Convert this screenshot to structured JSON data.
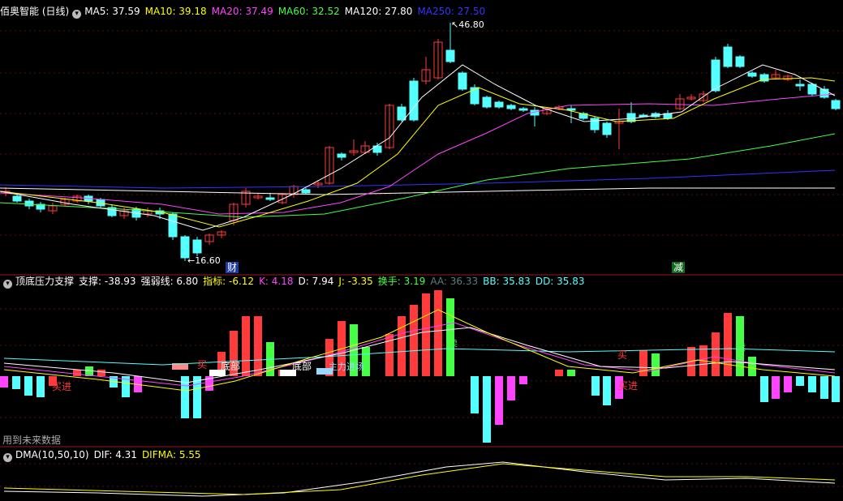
{
  "main": {
    "title": "佰奥智能 (日线)",
    "ma": [
      {
        "label": "MA5: 37.59",
        "color": "#ffffff"
      },
      {
        "label": "MA10: 39.18",
        "color": "#ffff00"
      },
      {
        "label": "MA20: 37.49",
        "color": "#ff44ff"
      },
      {
        "label": "MA60: 32.52",
        "color": "#44ff44"
      },
      {
        "label": "MA120: 27.80",
        "color": "#ffffff"
      },
      {
        "label": "MA250: 27.50",
        "color": "#3333ff"
      }
    ],
    "high_label": "46.80",
    "low_label": "16.60",
    "tag_cai": "财",
    "tag_jian": "减",
    "colors": {
      "up": "#ff3b3b",
      "down": "#54ffff"
    }
  },
  "indicator": {
    "title": "顶底压力支撑",
    "values": [
      {
        "label": "支撑: -38.93",
        "color": "#ffffff"
      },
      {
        "label": "强弱线: 6.80",
        "color": "#ffffff"
      },
      {
        "label": "指标: -6.12",
        "color": "#ffff00"
      },
      {
        "label": "K: 4.18",
        "color": "#ff44ff"
      },
      {
        "label": "D: 7.94",
        "color": "#ffffff"
      },
      {
        "label": "J: -3.35",
        "color": "#ffff00"
      },
      {
        "label": "换手: 3.19",
        "color": "#44ff44"
      },
      {
        "label": "AA: 36.33",
        "color": "#5a7d7d"
      },
      {
        "label": "BB: 35.83",
        "color": "#54ffff"
      },
      {
        "label": "DD: 35.83",
        "color": "#54ffff"
      }
    ],
    "labels": {
      "buy_in": "买进",
      "buy": "买",
      "bottom": "底部",
      "sell": "卖",
      "main_flow": "主力进场"
    },
    "footer": "用到未来数据"
  },
  "dma": {
    "title": "DMA(10,50,10)",
    "values": [
      {
        "label": "DIF: 4.31",
        "color": "#ffffff"
      },
      {
        "label": "DIFMA: 5.55",
        "color": "#ffff00"
      }
    ]
  }
}
